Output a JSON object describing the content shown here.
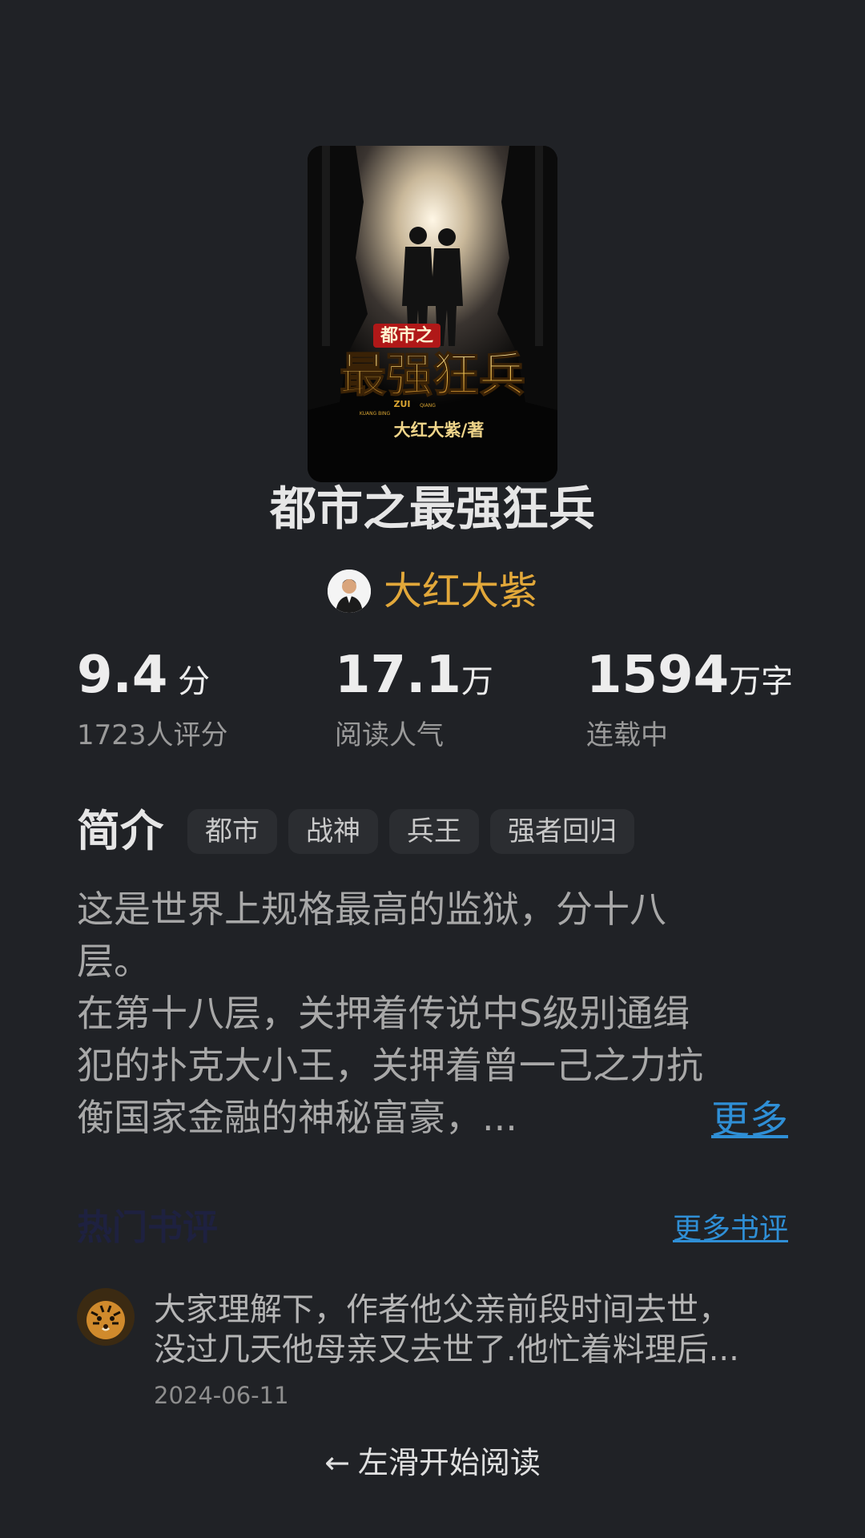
{
  "book": {
    "cover": {
      "small_title": "都市之",
      "big_title": "最强狂兵",
      "pinyin_1": "ZUI",
      "pinyin_2": "QIANG",
      "pinyin_3": "KUANG BING",
      "credit": "大红大紫/著"
    },
    "title": "都市之最强狂兵",
    "author": "大红大紫"
  },
  "stats": [
    {
      "value": "9.4",
      "unit": " 分",
      "label": "1723人评分"
    },
    {
      "value": "17.1",
      "unit": "万",
      "label": "阅读人气"
    },
    {
      "value": "1594",
      "unit": "万字",
      "label": "连载中"
    }
  ],
  "intro": {
    "title": "简介",
    "tags": [
      "都市",
      "战神",
      "兵王",
      "强者回归"
    ],
    "lines": [
      "这是世界上规格最高的监狱，分十八",
      "层。",
      "在第十八层，关押着传说中S级别通缉",
      "犯的扑克大小王，关押着曾一己之力抗",
      "衡国家金融的神秘富豪，..."
    ],
    "more_label": "更多"
  },
  "reviews": {
    "title": "热门书评",
    "more_label": "更多书评",
    "items": [
      {
        "line1": "大家理解下，作者他父亲前段时间去世，",
        "line2": "没过几天他母亲又去世了.他忙着料理后...",
        "date": "2024-06-11"
      }
    ]
  },
  "swipe_hint": {
    "arrow": "←",
    "label": "左滑开始阅读"
  },
  "colors": {
    "background": "#202226",
    "author": "#e2a83a",
    "link": "#2f8fd6",
    "cover_gold": "#f2c14e"
  }
}
